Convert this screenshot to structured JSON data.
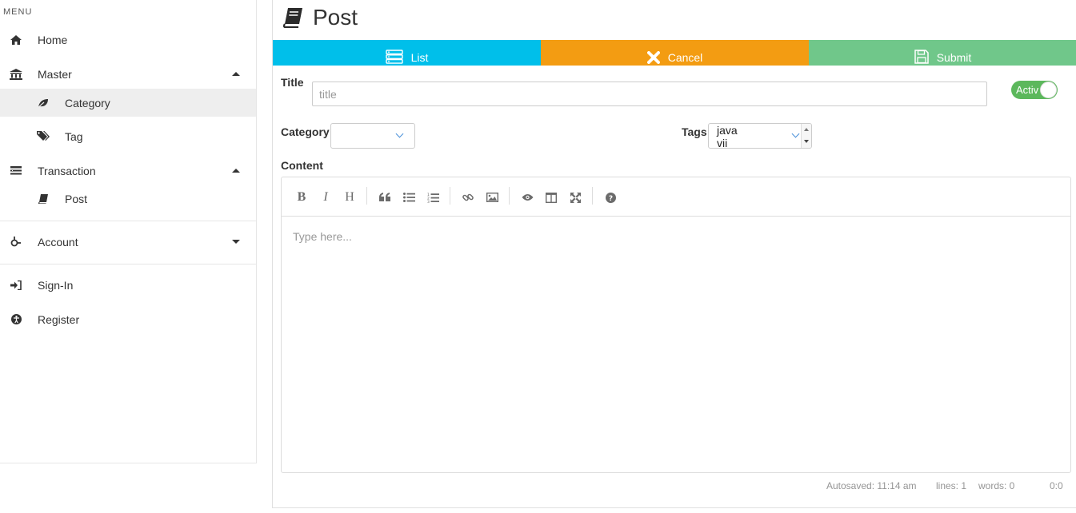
{
  "sidebar": {
    "menu_title": "MENU",
    "items": [
      {
        "label": "Home",
        "icon": "home-icon"
      },
      {
        "label": "Master",
        "icon": "bank-icon"
      },
      {
        "label": "Category",
        "icon": "leaf-icon"
      },
      {
        "label": "Tag",
        "icon": "tags-icon"
      },
      {
        "label": "Transaction",
        "icon": "list-icon"
      },
      {
        "label": "Post",
        "icon": "book-icon"
      },
      {
        "label": "Account",
        "icon": "user-icon"
      },
      {
        "label": "Sign-In",
        "icon": "sign-in-icon"
      },
      {
        "label": "Register",
        "icon": "accessibility-icon"
      }
    ]
  },
  "page": {
    "title": "Post",
    "icon": "book-icon"
  },
  "toolbar": {
    "list_label": "List",
    "cancel_label": "Cancel",
    "submit_label": "Submit",
    "colors": {
      "list": "#00bfea",
      "cancel": "#f39c12",
      "submit": "#70c78a"
    }
  },
  "form": {
    "title_label": "Title",
    "title_placeholder": "title",
    "toggle_label": "Activ",
    "category_label": "Category",
    "category_value": "",
    "tags_label": "Tags",
    "tags_options": [
      "java",
      "vii"
    ],
    "content_label": "Content",
    "content_placeholder": "Type here..."
  },
  "editor_toolbar": [
    "bold-icon",
    "italic-icon",
    "heading-icon",
    "quote-icon",
    "unordered-list-icon",
    "ordered-list-icon",
    "link-icon",
    "image-icon",
    "preview-icon",
    "side-by-side-icon",
    "fullscreen-icon",
    "help-icon"
  ],
  "statusbar": {
    "autosaved": "Autosaved: 11:14 am",
    "lines": "lines: 1",
    "words": "words: 0",
    "cursor": "0:0"
  }
}
